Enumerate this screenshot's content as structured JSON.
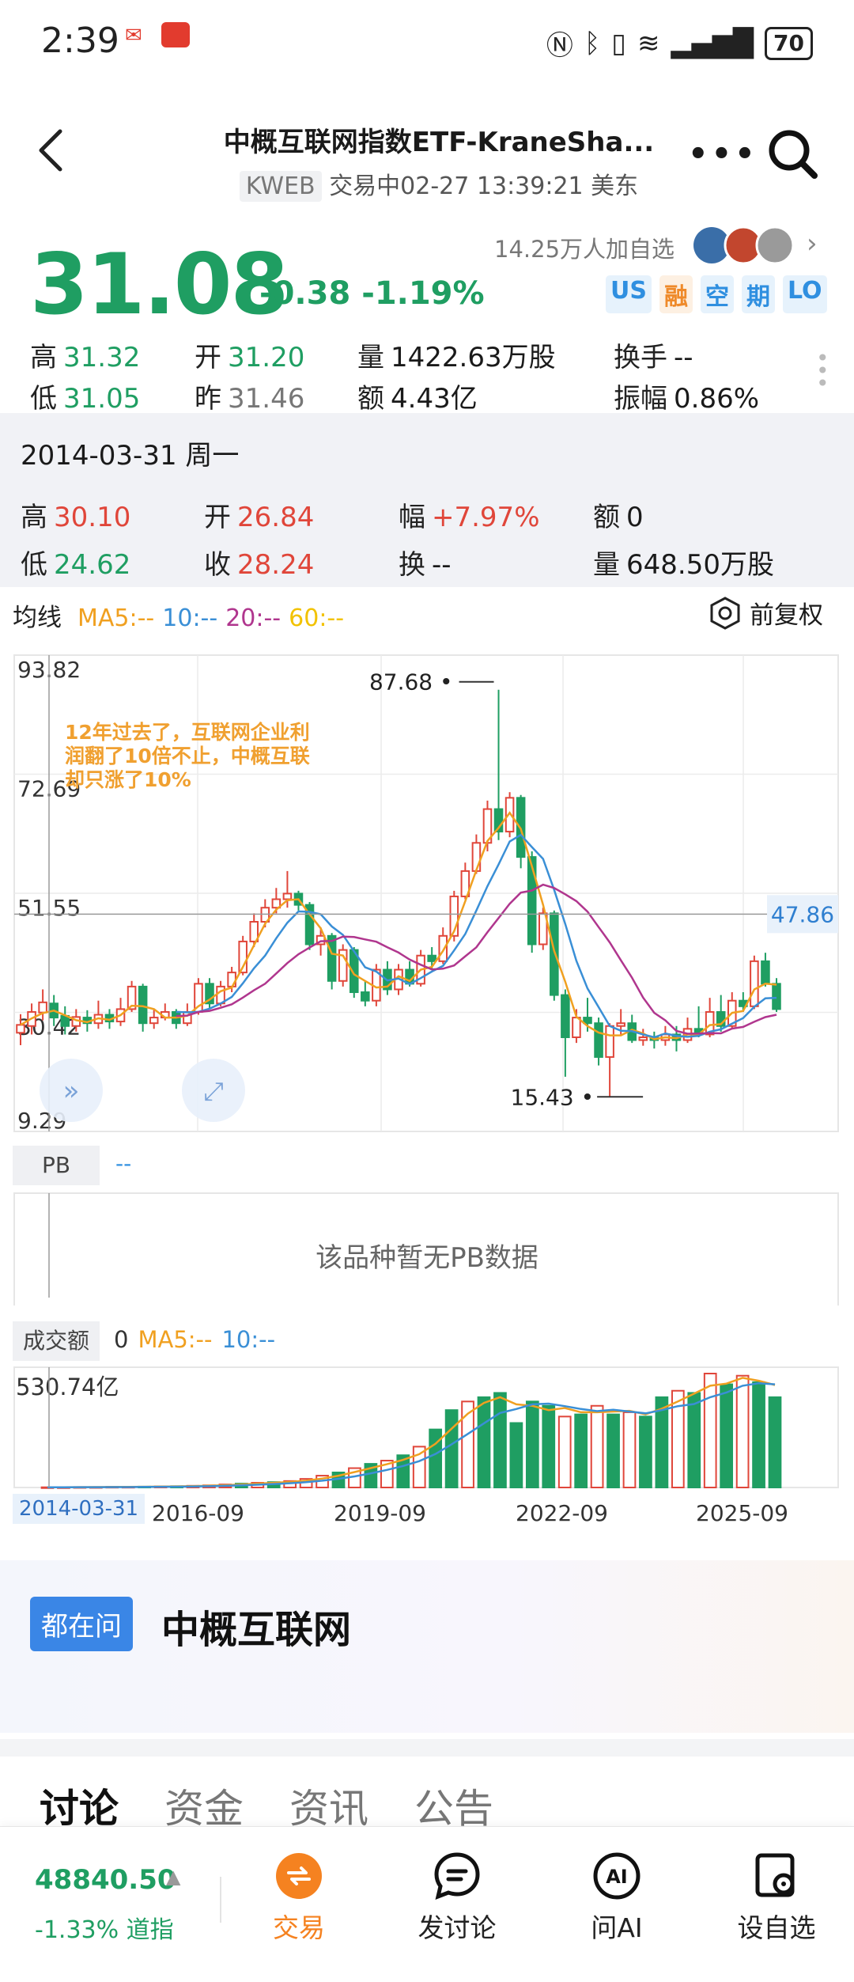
{
  "status_bar": {
    "time": "2:39",
    "battery": "70",
    "icons": [
      "mail-icon",
      "app-notification-icon",
      "nfc-icon",
      "bluetooth-icon",
      "vibrate-icon",
      "wifi-icon",
      "signal-icon"
    ]
  },
  "header": {
    "title": "中概互联网指数ETF-KraneSha...",
    "ticker": "KWEB",
    "status_line": "交易中02-27 13:39:21 美东"
  },
  "quote": {
    "price": "31.08",
    "change": "-0.38 -1.19%",
    "watchers": "14.25万人加自选",
    "badges": [
      "US",
      "融",
      "空",
      "期",
      "LO"
    ],
    "stats": [
      [
        {
          "label": "高",
          "value": "31.32",
          "color": "green"
        },
        {
          "label": "开",
          "value": "31.20",
          "color": "green"
        },
        {
          "label": "量",
          "value": "1422.63万股",
          "color": "plain"
        },
        {
          "label": "换手",
          "value": "--",
          "color": "plain"
        }
      ],
      [
        {
          "label": "低",
          "value": "31.05",
          "color": "green"
        },
        {
          "label": "昨",
          "value": "31.46",
          "color": "grey"
        },
        {
          "label": "额",
          "value": "4.43亿",
          "color": "plain"
        },
        {
          "label": "振幅",
          "value": "0.86%",
          "color": "plain"
        }
      ]
    ]
  },
  "day_detail": {
    "date": "2014-03-31 周一",
    "stats": [
      [
        {
          "label": "高",
          "value": "30.10",
          "color": "red"
        },
        {
          "label": "开",
          "value": "26.84",
          "color": "red"
        },
        {
          "label": "幅",
          "value": "+7.97%",
          "color": "red"
        },
        {
          "label": "额",
          "value": "0",
          "color": "plain"
        }
      ],
      [
        {
          "label": "低",
          "value": "24.62",
          "color": "green"
        },
        {
          "label": "收",
          "value": "28.24",
          "color": "red"
        },
        {
          "label": "换",
          "value": "--",
          "color": "plain"
        },
        {
          "label": "量",
          "value": "648.50万股",
          "color": "plain"
        }
      ]
    ]
  },
  "ma_legend": {
    "title": "均线",
    "items": [
      {
        "text": "MA5:--",
        "color": "#f0a020"
      },
      {
        "text": "10:--",
        "color": "#3a8fd6"
      },
      {
        "text": "20:--",
        "color": "#b0368e"
      },
      {
        "text": "60:--",
        "color": "#f2c200"
      }
    ],
    "fuquan": "前复权"
  },
  "chart_data": {
    "type": "candlestick",
    "y_axis_labels": [
      "93.82",
      "72.69",
      "51.55",
      "30.42",
      "9.29"
    ],
    "ylim": [
      9.29,
      93.82
    ],
    "max_label": "87.68",
    "min_label": "15.43",
    "price_line_label": "47.86",
    "annotation": "12年过去了，互联网企业利润翻了10倍不止，中概互联却只涨了10%",
    "candles": [
      {
        "o": 26.8,
        "c": 28.2,
        "h": 30.1,
        "l": 24.6
      },
      {
        "o": 28.0,
        "c": 30.5,
        "h": 32.0,
        "l": 26.5
      },
      {
        "o": 30.4,
        "c": 32.2,
        "h": 34.5,
        "l": 29.0
      },
      {
        "o": 32.0,
        "c": 29.5,
        "h": 33.5,
        "l": 28.0
      },
      {
        "o": 29.8,
        "c": 28.0,
        "h": 31.5,
        "l": 26.5
      },
      {
        "o": 28.0,
        "c": 29.6,
        "h": 31.0,
        "l": 27.0
      },
      {
        "o": 29.5,
        "c": 28.5,
        "h": 30.8,
        "l": 27.0
      },
      {
        "o": 28.5,
        "c": 30.0,
        "h": 32.5,
        "l": 27.5
      },
      {
        "o": 30.0,
        "c": 28.8,
        "h": 31.0,
        "l": 27.5
      },
      {
        "o": 28.8,
        "c": 31.0,
        "h": 33.0,
        "l": 28.0
      },
      {
        "o": 31.0,
        "c": 35.0,
        "h": 36.0,
        "l": 30.5
      },
      {
        "o": 35.0,
        "c": 28.5,
        "h": 35.5,
        "l": 27.0
      },
      {
        "o": 28.5,
        "c": 29.5,
        "h": 31.0,
        "l": 27.5
      },
      {
        "o": 29.5,
        "c": 30.5,
        "h": 32.0,
        "l": 29.0
      },
      {
        "o": 30.5,
        "c": 28.5,
        "h": 31.0,
        "l": 27.5
      },
      {
        "o": 28.5,
        "c": 30.5,
        "h": 32.0,
        "l": 28.0
      },
      {
        "o": 30.5,
        "c": 35.5,
        "h": 36.5,
        "l": 30.0
      },
      {
        "o": 35.5,
        "c": 32.0,
        "h": 36.5,
        "l": 31.0
      },
      {
        "o": 32.0,
        "c": 35.0,
        "h": 36.0,
        "l": 31.5
      },
      {
        "o": 35.0,
        "c": 37.5,
        "h": 38.5,
        "l": 34.0
      },
      {
        "o": 37.5,
        "c": 43.0,
        "h": 44.0,
        "l": 37.0
      },
      {
        "o": 43.0,
        "c": 46.5,
        "h": 48.0,
        "l": 42.0
      },
      {
        "o": 46.5,
        "c": 49.0,
        "h": 50.5,
        "l": 45.5
      },
      {
        "o": 49.0,
        "c": 50.5,
        "h": 52.5,
        "l": 48.0
      },
      {
        "o": 50.5,
        "c": 51.5,
        "h": 55.5,
        "l": 49.0
      },
      {
        "o": 51.5,
        "c": 49.5,
        "h": 52.0,
        "l": 48.5
      },
      {
        "o": 49.5,
        "c": 42.5,
        "h": 50.0,
        "l": 41.5
      },
      {
        "o": 42.5,
        "c": 44.0,
        "h": 45.5,
        "l": 40.5
      },
      {
        "o": 44.0,
        "c": 36.0,
        "h": 44.5,
        "l": 34.5
      },
      {
        "o": 36.0,
        "c": 41.5,
        "h": 42.5,
        "l": 35.0
      },
      {
        "o": 41.5,
        "c": 34.0,
        "h": 42.0,
        "l": 33.0
      },
      {
        "o": 34.0,
        "c": 32.5,
        "h": 36.0,
        "l": 31.5
      },
      {
        "o": 32.5,
        "c": 38.0,
        "h": 39.0,
        "l": 31.5
      },
      {
        "o": 38.0,
        "c": 34.5,
        "h": 39.5,
        "l": 33.5
      },
      {
        "o": 34.5,
        "c": 38.0,
        "h": 39.0,
        "l": 33.5
      },
      {
        "o": 38.0,
        "c": 35.5,
        "h": 39.5,
        "l": 35.0
      },
      {
        "o": 35.5,
        "c": 40.5,
        "h": 41.5,
        "l": 35.0
      },
      {
        "o": 40.5,
        "c": 39.5,
        "h": 42.0,
        "l": 38.0
      },
      {
        "o": 39.5,
        "c": 44.0,
        "h": 45.5,
        "l": 39.0
      },
      {
        "o": 44.0,
        "c": 51.0,
        "h": 52.0,
        "l": 43.0
      },
      {
        "o": 51.0,
        "c": 55.5,
        "h": 57.0,
        "l": 50.5
      },
      {
        "o": 55.5,
        "c": 60.5,
        "h": 62.0,
        "l": 55.0
      },
      {
        "o": 60.5,
        "c": 66.5,
        "h": 68.0,
        "l": 59.0
      },
      {
        "o": 66.5,
        "c": 62.5,
        "h": 87.68,
        "l": 61.0
      },
      {
        "o": 62.5,
        "c": 68.5,
        "h": 69.5,
        "l": 61.5
      },
      {
        "o": 68.5,
        "c": 58.0,
        "h": 69.0,
        "l": 56.0
      },
      {
        "o": 58.0,
        "c": 42.5,
        "h": 59.0,
        "l": 41.0
      },
      {
        "o": 42.5,
        "c": 48.0,
        "h": 49.0,
        "l": 41.5
      },
      {
        "o": 48.0,
        "c": 33.5,
        "h": 48.5,
        "l": 32.5
      },
      {
        "o": 33.5,
        "c": 26.0,
        "h": 34.5,
        "l": 19.0
      },
      {
        "o": 26.0,
        "c": 29.5,
        "h": 31.0,
        "l": 25.0
      },
      {
        "o": 29.5,
        "c": 28.5,
        "h": 33.0,
        "l": 27.0
      },
      {
        "o": 28.5,
        "c": 22.5,
        "h": 29.5,
        "l": 21.0
      },
      {
        "o": 22.5,
        "c": 28.0,
        "h": 28.5,
        "l": 15.43
      },
      {
        "o": 28.0,
        "c": 28.5,
        "h": 31.0,
        "l": 26.5
      },
      {
        "o": 28.5,
        "c": 25.5,
        "h": 30.0,
        "l": 25.0
      },
      {
        "o": 25.5,
        "c": 26.0,
        "h": 27.5,
        "l": 24.5
      },
      {
        "o": 26.0,
        "c": 25.5,
        "h": 27.0,
        "l": 24.0
      },
      {
        "o": 25.5,
        "c": 26.5,
        "h": 28.0,
        "l": 24.5
      },
      {
        "o": 26.5,
        "c": 25.5,
        "h": 28.0,
        "l": 23.5
      },
      {
        "o": 25.5,
        "c": 27.5,
        "h": 29.5,
        "l": 25.0
      },
      {
        "o": 27.5,
        "c": 26.5,
        "h": 31.5,
        "l": 26.0
      },
      {
        "o": 26.5,
        "c": 30.5,
        "h": 33.0,
        "l": 26.0
      },
      {
        "o": 30.5,
        "c": 28.0,
        "h": 33.5,
        "l": 27.0
      },
      {
        "o": 28.0,
        "c": 32.5,
        "h": 34.0,
        "l": 27.5
      },
      {
        "o": 32.5,
        "c": 31.5,
        "h": 34.0,
        "l": 30.5
      },
      {
        "o": 31.5,
        "c": 39.5,
        "h": 40.5,
        "l": 31.0
      },
      {
        "o": 39.5,
        "c": 35.5,
        "h": 41.0,
        "l": 35.0
      },
      {
        "o": 35.5,
        "c": 31.0,
        "h": 36.5,
        "l": 30.5
      }
    ]
  },
  "pb": {
    "label": "PB",
    "value": "--",
    "empty_text": "该品种暂无PB数据"
  },
  "turnover": {
    "label": "成交额",
    "value": "0",
    "ma": [
      {
        "text": "MA5:--",
        "color": "#f0a020"
      },
      {
        "text": "10:--",
        "color": "#3a8fd6"
      }
    ],
    "max_label": "530.74亿",
    "x_labels": [
      "2014-03-31",
      "2016-09",
      "2019-09",
      "2022-09",
      "2025-09"
    ],
    "values": [
      1,
      1,
      2,
      2,
      3,
      3,
      4,
      5,
      6,
      8,
      10,
      14,
      18,
      22,
      25,
      30,
      40,
      55,
      70,
      90,
      110,
      125,
      150,
      190,
      270,
      360,
      400,
      420,
      440,
      300,
      400,
      380,
      330,
      340,
      380,
      340,
      350,
      330,
      420,
      450,
      440,
      530,
      480,
      520,
      490,
      420
    ],
    "up": [
      true,
      true,
      true,
      true,
      true,
      true,
      false,
      true,
      false,
      true,
      true,
      true,
      false,
      true,
      false,
      true,
      true,
      true,
      false,
      true,
      false,
      true,
      false,
      true,
      false,
      false,
      true,
      false,
      false,
      false,
      false,
      false,
      true,
      false,
      true,
      false,
      true,
      false,
      false,
      true,
      false,
      true,
      false,
      true,
      false,
      false
    ]
  },
  "ask": {
    "badge": "都在问",
    "title": "中概互联网"
  },
  "tabs": [
    "讨论",
    "资金",
    "资讯",
    "公告"
  ],
  "bottom_nav": {
    "index_value": "48840.50",
    "index_change": "-1.33% 道指",
    "items": [
      "交易",
      "发讨论",
      "问AI",
      "设自选"
    ]
  }
}
